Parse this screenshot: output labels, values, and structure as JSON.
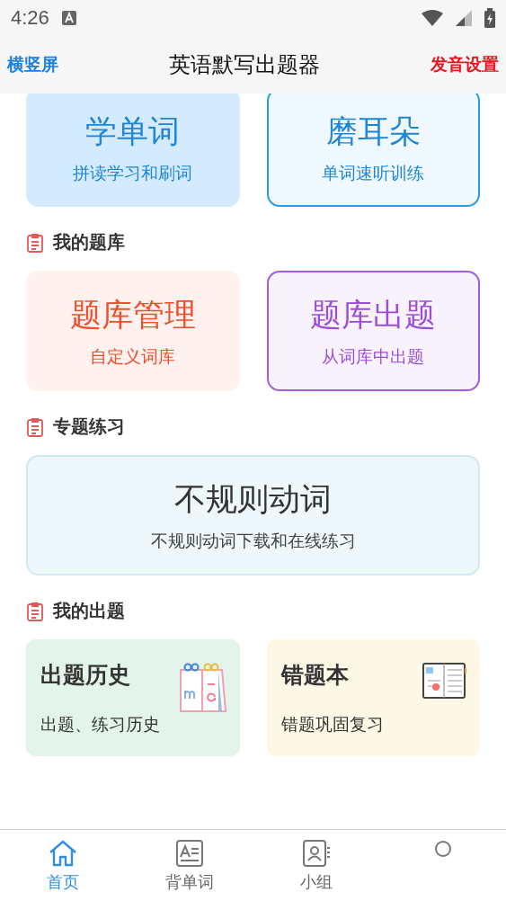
{
  "status_bar": {
    "time": "4:26"
  },
  "header": {
    "left": "横竖屏",
    "title": "英语默写出题器",
    "right": "发音设置"
  },
  "top_cards": [
    {
      "title": "学单词",
      "subtitle": "拼读学习和刷词",
      "kind": "filled"
    },
    {
      "title": "磨耳朵",
      "subtitle": "单词速听训练",
      "kind": "outlined"
    }
  ],
  "sections": [
    {
      "heading": "我的题库",
      "kind": "pair",
      "cards": [
        {
          "title": "题库管理",
          "subtitle": "自定义词库",
          "kind": "filled"
        },
        {
          "title": "题库出题",
          "subtitle": "从词库中出题",
          "kind": "outlined"
        }
      ]
    },
    {
      "heading": "专题练习",
      "kind": "wide",
      "cards": [
        {
          "title": "不规则动词",
          "subtitle": "不规则动词下载和在线练习",
          "kind": "filled"
        }
      ]
    },
    {
      "heading": "我的出题",
      "kind": "tile",
      "cards": [
        {
          "title": "出题历史",
          "subtitle": "出题、练习历史",
          "kind": "calendar"
        },
        {
          "title": "错题本",
          "subtitle": "错题巩固复习",
          "kind": "notebook"
        }
      ]
    }
  ],
  "tabs": [
    {
      "label": "首页",
      "kind": "home",
      "selected": true
    },
    {
      "label": "背单词",
      "kind": "card",
      "selected": false
    },
    {
      "label": "小组",
      "kind": "contact",
      "selected": false
    },
    {
      "kind": "person",
      "selected": false
    }
  ]
}
